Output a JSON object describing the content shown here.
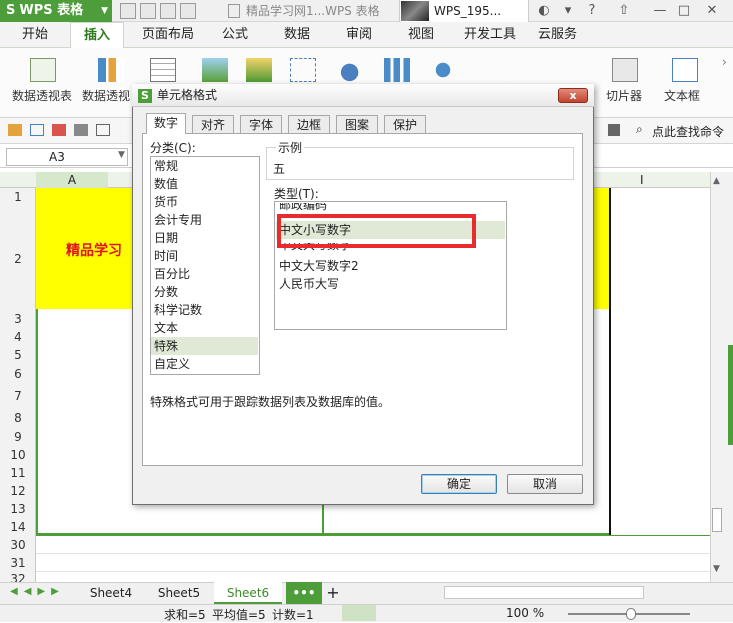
{
  "app": {
    "name": "WPS 表格",
    "doc_title": "精品学习网1...WPS 表格",
    "user": "WPS_195..."
  },
  "menu": {
    "tabs": [
      "开始",
      "插入",
      "页面布局",
      "公式",
      "数据",
      "审阅",
      "视图",
      "开发工具",
      "云服务"
    ],
    "active": "插入"
  },
  "ribbon": {
    "pivot_table": "数据透视表",
    "pivot_chart": "数据透视",
    "slicer": "切片器",
    "textbox": "文本框",
    "find_command": "点此查找命令"
  },
  "formula": {
    "name_box": "A3"
  },
  "grid": {
    "col_a": "A",
    "col_i": "I",
    "rows": [
      "1",
      "2",
      "3",
      "4",
      "5",
      "6",
      "7",
      "8",
      "9",
      "10",
      "11",
      "12",
      "13",
      "14",
      "30",
      "31",
      "32"
    ],
    "cell_text": "精品学习"
  },
  "sheets": {
    "tabs": [
      "Sheet4",
      "Sheet5",
      "Sheet6"
    ],
    "active": "Sheet6",
    "more": "•••",
    "add": "+"
  },
  "status": {
    "sum": "求和=5",
    "avg": "平均值=5",
    "count": "计数=1",
    "zoom": "100 %"
  },
  "dialog": {
    "title": "单元格格式",
    "close": "x",
    "tabs": [
      "数字",
      "对齐",
      "字体",
      "边框",
      "图案",
      "保护"
    ],
    "active_tab": "数字",
    "category_label": "分类(C):",
    "categories": [
      "常规",
      "数值",
      "货币",
      "会计专用",
      "日期",
      "时间",
      "百分比",
      "分数",
      "科学记数",
      "文本",
      "特殊",
      "自定义"
    ],
    "selected_category": "特殊",
    "sample_label": "示例",
    "sample_value": "五",
    "type_label": "类型(T):",
    "types": [
      "邮政编码",
      "中文小写数字",
      "中文大写数字",
      "中文大写数字2",
      "人民币大写"
    ],
    "selected_type": "中文小写数字",
    "description": "特殊格式可用于跟踪数据列表及数据库的值。",
    "ok": "确定",
    "cancel": "取消"
  },
  "colors": {
    "brand_green": "#4d9e3a",
    "highlight_red": "#e82c2c",
    "cell_yellow": "#ffff00",
    "cell_text_red": "#e0141b"
  }
}
